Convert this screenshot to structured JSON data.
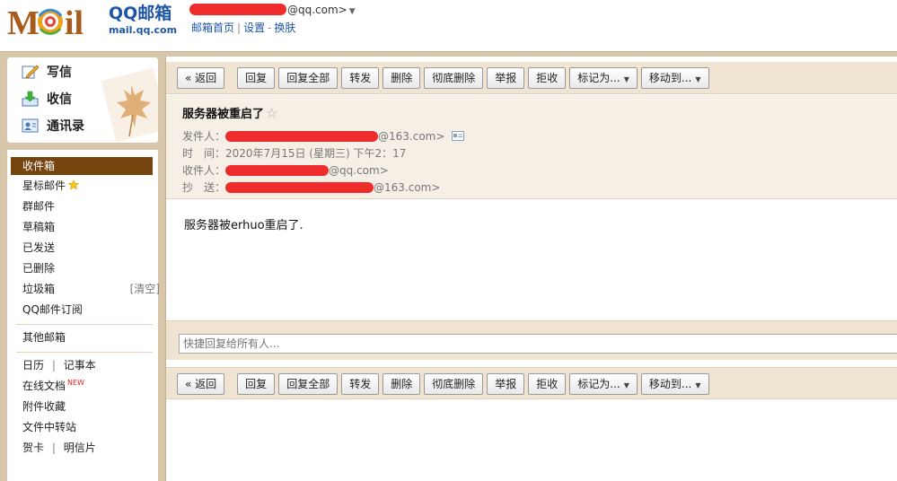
{
  "header": {
    "logo_text": "MAIL",
    "brand_cn": "QQ邮箱",
    "brand_domain": "mail.qq.com",
    "account_suffix": "@qq.com>",
    "links": [
      "邮箱首页",
      "设置",
      "换肤"
    ],
    "link_seps": [
      "|",
      "-"
    ]
  },
  "sidebar": {
    "commands": [
      {
        "label": "写信",
        "icon": "pencil-icon"
      },
      {
        "label": "收信",
        "icon": "inbox-download-icon"
      },
      {
        "label": "通讯录",
        "icon": "contacts-icon"
      }
    ],
    "folders": {
      "inbox": "收件箱",
      "starred": "星标邮件",
      "group": "群邮件",
      "drafts": "草稿箱",
      "sent": "已发送",
      "deleted": "已删除",
      "spam": "垃圾箱",
      "spam_clear": "[清空]",
      "subscriptions": "QQ邮件订阅",
      "other": "其他邮箱",
      "calendar": "日历",
      "notes": "记事本",
      "docs": "在线文档",
      "docs_badge": "NEW",
      "attachments": "附件收藏",
      "transfer": "文件中转站",
      "cards": "贺卡",
      "postcards": "明信片",
      "sep": "|"
    }
  },
  "toolbar": {
    "back": "« 返回",
    "reply": "回复",
    "reply_all": "回复全部",
    "forward": "转发",
    "delete": "删除",
    "delete_perm": "彻底删除",
    "report": "举报",
    "reject": "拒收",
    "mark_as": "标记为...",
    "move_to": "移动到..."
  },
  "message": {
    "subject": "服务器被重启了",
    "from_label": "发件人：",
    "from_suffix": "@163.com>",
    "time_label": "时　间：",
    "time_value": "2020年7月15日 (星期三) 下午2：17",
    "to_label": "收件人：",
    "to_suffix": "@qq.com>",
    "cc_label": "抄　送：",
    "cc_suffix": "@163.com>",
    "body": "服务器被erhuo重启了."
  },
  "reply_box": {
    "placeholder": "快捷回复给所有人..."
  },
  "colors": {
    "active_folder": "#76440f",
    "frame": "#d8c6aa",
    "toolbar": "#efe3d1",
    "redaction": "#ee2c2c",
    "brand_blue": "#1e55a6"
  }
}
